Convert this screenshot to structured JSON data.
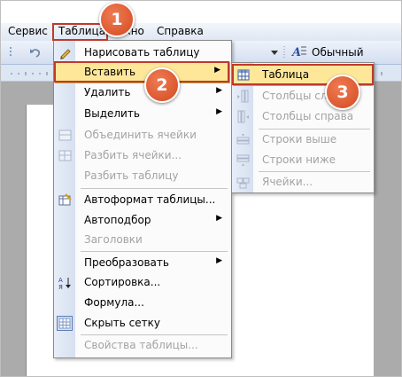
{
  "menubar": {
    "items": [
      "Сервис",
      "Таблица",
      "Окно",
      "Справка"
    ]
  },
  "toolbar": {
    "style_value": "Обычный",
    "style_icon": "styles-icon"
  },
  "table_menu": {
    "items": [
      {
        "label": "Нарисовать таблицу",
        "icon": "pencil-icon"
      },
      {
        "label": "Вставить",
        "submenu": true,
        "highlighted": true
      },
      {
        "label": "Удалить",
        "submenu": true
      },
      {
        "label": "Выделить",
        "submenu": true
      },
      {
        "label": "Объединить ячейки",
        "disabled": true,
        "icon": "merge-cells-icon"
      },
      {
        "label": "Разбить ячейки...",
        "disabled": true,
        "icon": "split-cells-icon"
      },
      {
        "label": "Разбить таблицу",
        "disabled": true
      },
      {
        "label": "Автоформат таблицы...",
        "icon": "table-autoformat-icon"
      },
      {
        "label": "Автоподбор",
        "submenu": true
      },
      {
        "label": "Заголовки",
        "disabled": true
      },
      {
        "label": "Преобразовать",
        "submenu": true
      },
      {
        "label": "Сортировка...",
        "icon": "sort-az-icon"
      },
      {
        "label": "Формула..."
      },
      {
        "label": "Скрыть сетку",
        "icon": "gridlines-icon"
      },
      {
        "label": "Свойства таблицы...",
        "disabled": true
      }
    ]
  },
  "insert_submenu": {
    "items": [
      {
        "label": "Таблица",
        "highlighted": true,
        "icon": "table-icon"
      },
      {
        "label": "Столбцы слева",
        "disabled": true,
        "icon": "insert-columns-left-icon"
      },
      {
        "label": "Столбцы справа",
        "disabled": true,
        "icon": "insert-columns-right-icon"
      },
      {
        "label": "Строки выше",
        "disabled": true,
        "icon": "insert-rows-above-icon"
      },
      {
        "label": "Строки ниже",
        "disabled": true,
        "icon": "insert-rows-below-icon"
      },
      {
        "label": "Ячейки...",
        "disabled": true,
        "icon": "insert-cells-icon"
      }
    ]
  },
  "callouts": [
    "1",
    "2",
    "3"
  ],
  "colors": {
    "highlight": "#ffe79a",
    "callout": "#d24a21",
    "annotation_box": "#c0392b"
  }
}
